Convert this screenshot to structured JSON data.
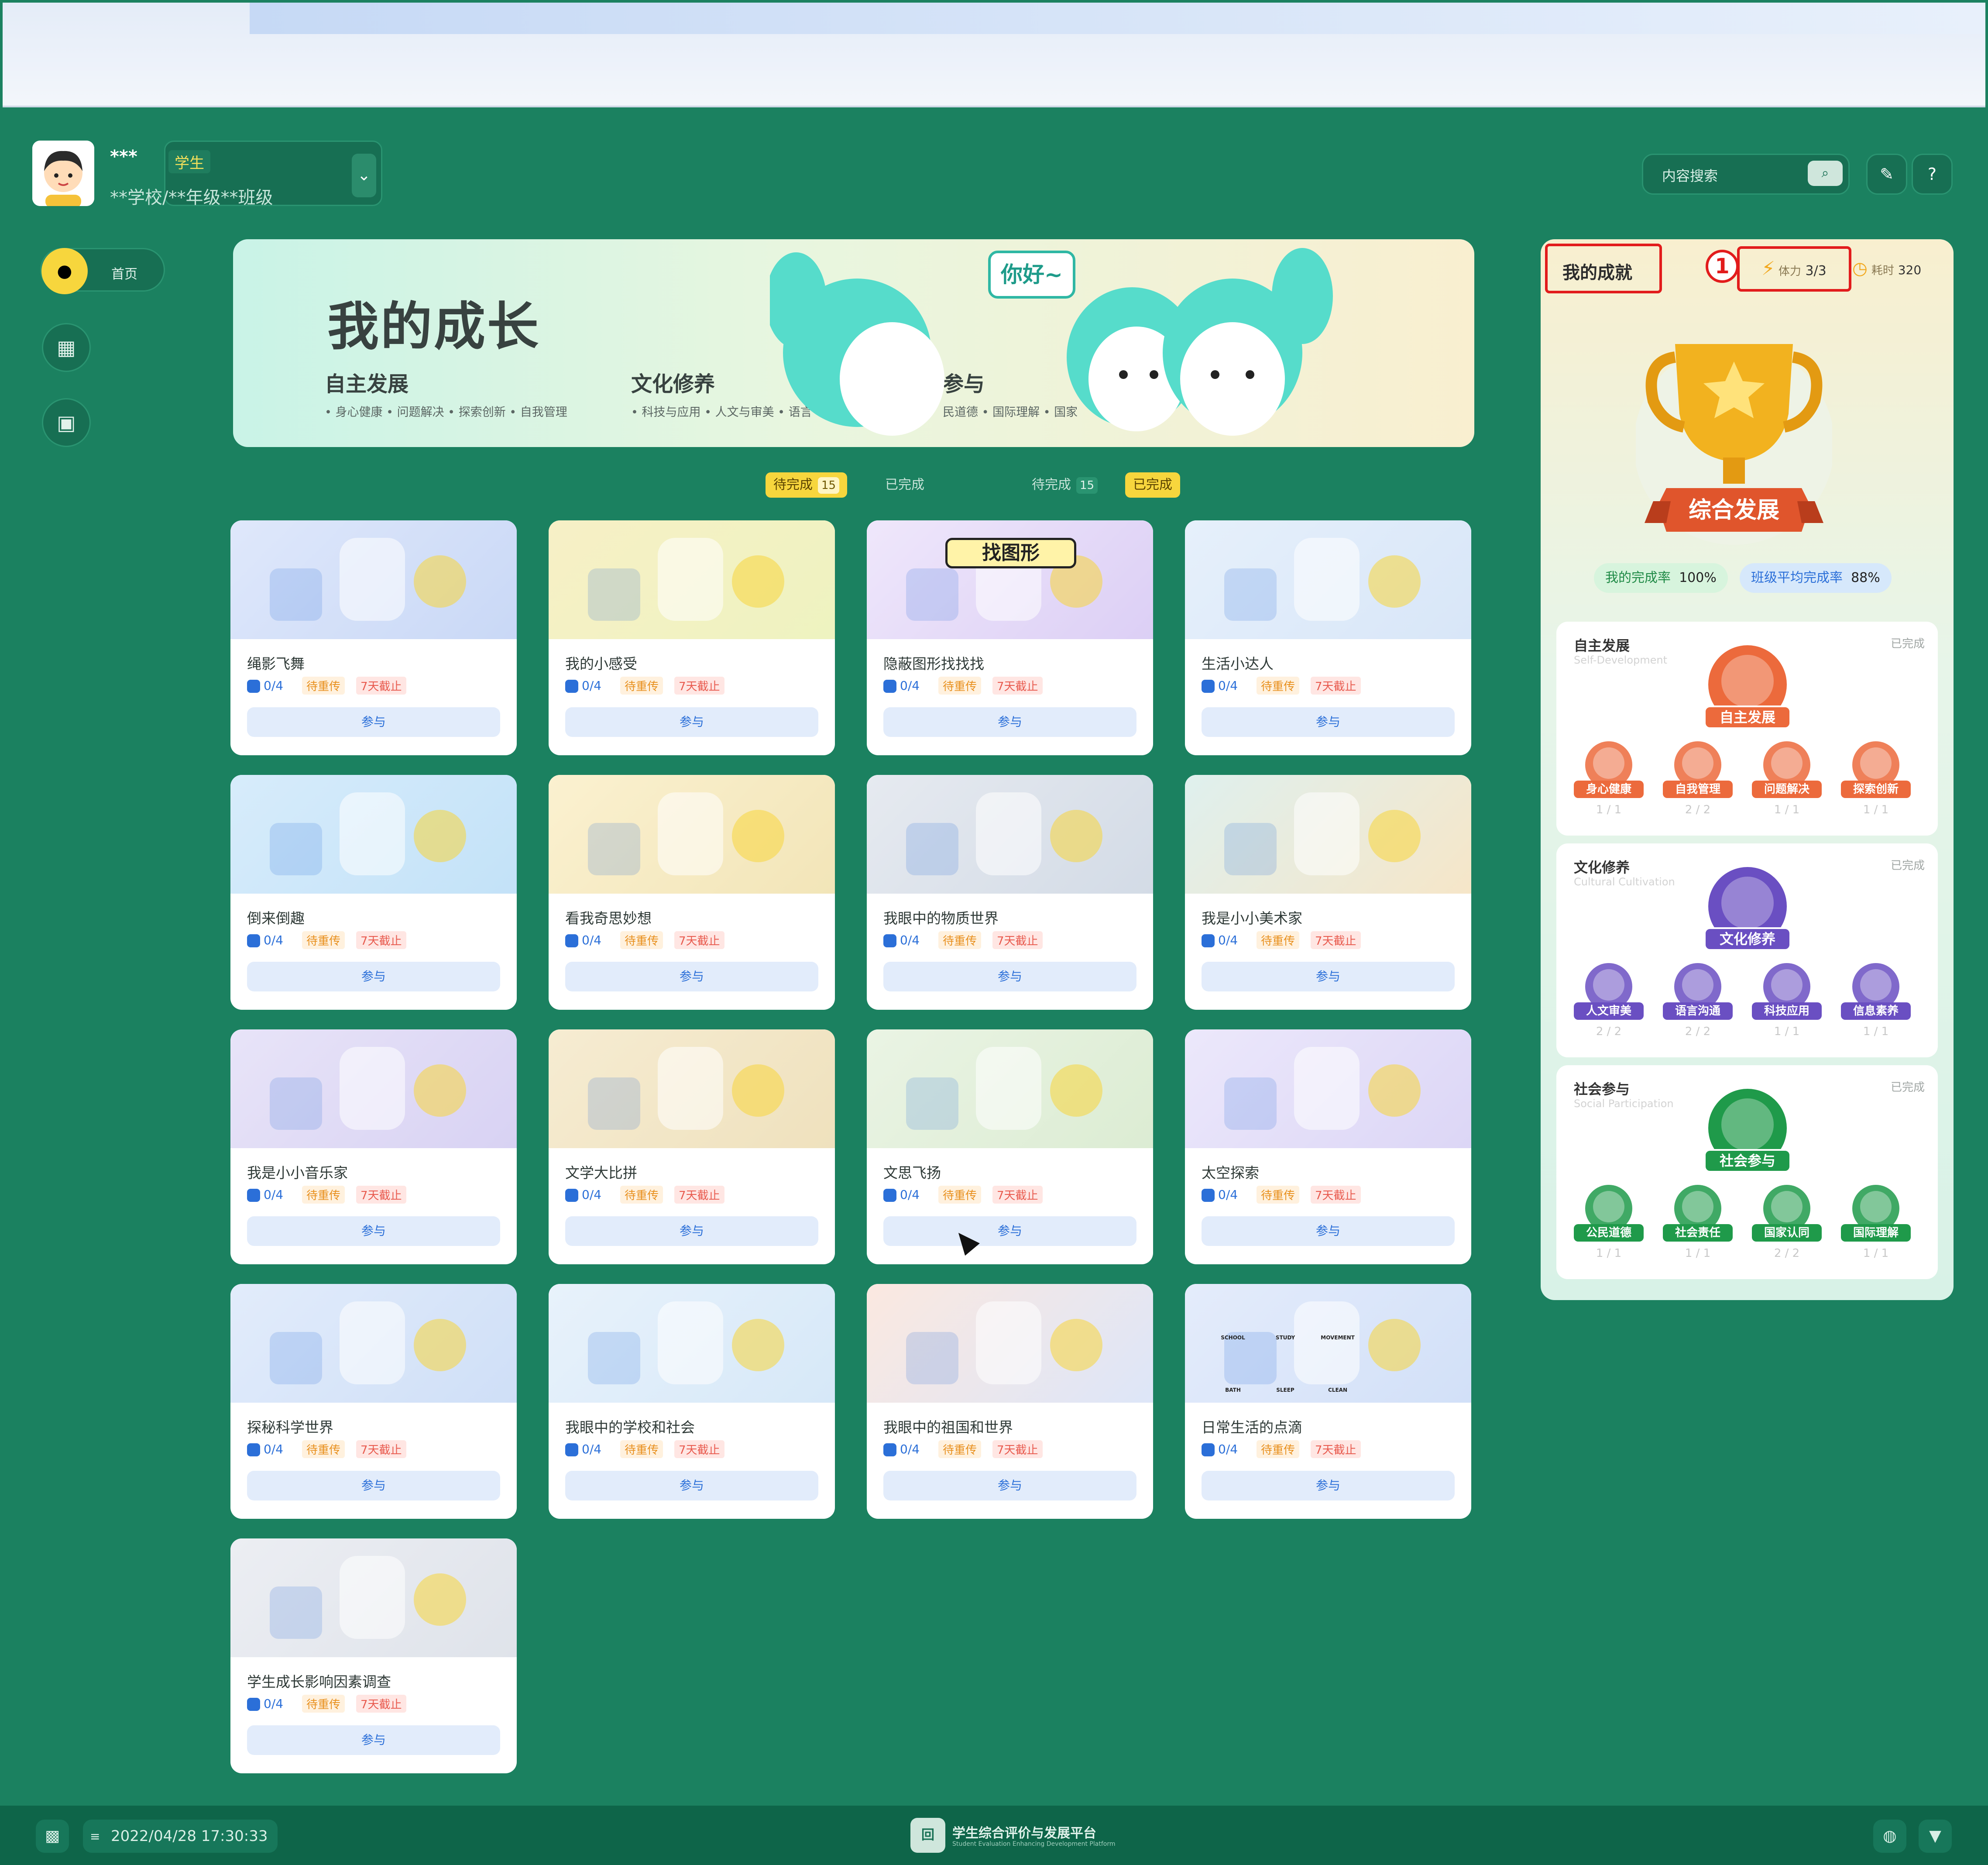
{
  "header": {
    "user_name": "***",
    "role": "学生",
    "school": "**学校/**年级**班级",
    "search_placeholder": "内容搜索"
  },
  "nav": {
    "home_label": "首页"
  },
  "banner": {
    "title": "我的成长",
    "hello": "你好~",
    "categories": [
      {
        "name": "自主发展",
        "items": "• 身心健康   • 问题解决   • 探索创新   • 自我管理"
      },
      {
        "name": "文化修养",
        "items": "• 科技与应用   • 人文与审美   • 语言"
      },
      {
        "name": "参与",
        "items": "民道德   • 国际理解   • 国家"
      }
    ]
  },
  "tabs": [
    {
      "label": "待完成",
      "count": "15"
    },
    {
      "label": "已完成"
    },
    {
      "label": "待完成",
      "count": "15"
    },
    {
      "label": "已完成"
    }
  ],
  "card_common": {
    "progress": "0/4",
    "status": "待重传",
    "deadline": "7天截止",
    "join": "参与"
  },
  "cards": [
    {
      "title": "绳影飞舞"
    },
    {
      "title": "我的小感受"
    },
    {
      "title": "隐蔽图形找找找"
    },
    {
      "title": "生活小达人"
    },
    {
      "title": "倒来倒趣"
    },
    {
      "title": "看我奇思妙想"
    },
    {
      "title": "我眼中的物质世界"
    },
    {
      "title": "我是小小美术家"
    },
    {
      "title": "我是小小音乐家"
    },
    {
      "title": "文学大比拼"
    },
    {
      "title": "文思飞扬"
    },
    {
      "title": "太空探索"
    },
    {
      "title": "探秘科学世界"
    },
    {
      "title": "我眼中的学校和社会"
    },
    {
      "title": "我眼中的祖国和世界"
    },
    {
      "title": "日常生活的点滴"
    },
    {
      "title": "学生成长影响因素调查"
    }
  ],
  "card_graphics": {
    "find_shapes_banner": "找图形",
    "daily_labels": [
      "SCHOOL",
      "STUDY",
      "MOVEMENT",
      "BATH",
      "SLEEP",
      "CLEAN"
    ]
  },
  "achievements": {
    "title": "我的成就",
    "marker": "1",
    "stamina_label": "体力",
    "stamina": "3/3",
    "time_label": "耗时",
    "time": "320",
    "trophy_label": "综合发展",
    "my_rate_label": "我的完成率",
    "my_rate": "100%",
    "class_rate_label": "班级平均完成率",
    "class_rate": "88%",
    "sections": [
      {
        "title": "自主发展",
        "subtitle": "Self-Development",
        "status": "已完成",
        "badge": "自主发展",
        "color": "#ec6a3c",
        "items": [
          {
            "name": "身心健康",
            "count": "1 / 1"
          },
          {
            "name": "自我管理",
            "count": "2 / 2"
          },
          {
            "name": "问题解决",
            "count": "1 / 1"
          },
          {
            "name": "探索创新",
            "count": "1 / 1"
          }
        ]
      },
      {
        "title": "文化修养",
        "subtitle": "Cultural Cultivation",
        "status": "已完成",
        "badge": "文化修养",
        "color": "#6a4fc2",
        "items": [
          {
            "name": "人文审美",
            "count": "2 / 2"
          },
          {
            "name": "语言沟通",
            "count": "2 / 2"
          },
          {
            "name": "科技应用",
            "count": "1 / 1"
          },
          {
            "name": "信息素养",
            "count": "1 / 1"
          }
        ]
      },
      {
        "title": "社会参与",
        "subtitle": "Social Participation",
        "status": "已完成",
        "badge": "社会参与",
        "color": "#1f9a4a",
        "items": [
          {
            "name": "公民道德",
            "count": "1 / 1"
          },
          {
            "name": "社会责任",
            "count": "1 / 1"
          },
          {
            "name": "国家认同",
            "count": "2 / 2"
          },
          {
            "name": "国际理解",
            "count": "1 / 1"
          }
        ]
      }
    ]
  },
  "footer": {
    "datetime": "2022/04/28   17:30:33",
    "platform": "学生综合评价与发展平台",
    "platform_en": "Student Evaluation Enhancing Development Platform"
  }
}
